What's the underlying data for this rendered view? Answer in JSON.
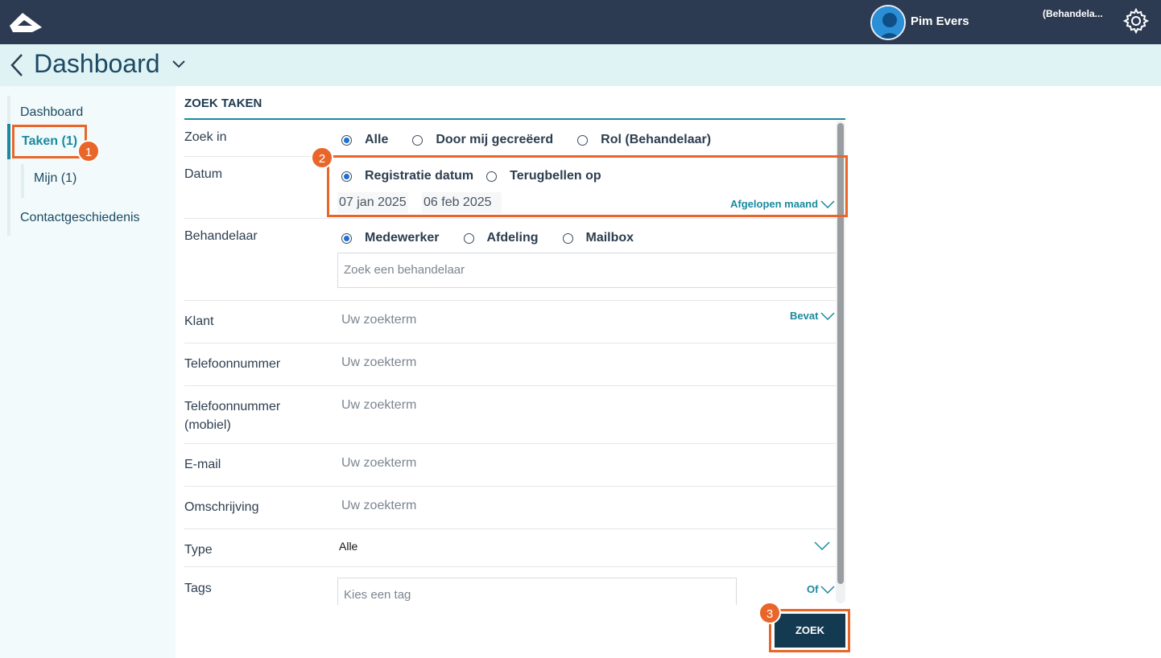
{
  "header": {
    "user_name": "Pim Evers",
    "role": "(Behandela..."
  },
  "titlebar": {
    "title": "Dashboard"
  },
  "sidebar": {
    "items": [
      {
        "label": "Dashboard"
      },
      {
        "label": "Taken (1)"
      },
      {
        "label": "Mijn (1)"
      },
      {
        "label": "Contactgeschiedenis"
      }
    ]
  },
  "panel": {
    "title": "ZOEK TAKEN",
    "zoek_in": {
      "label": "Zoek in",
      "options": [
        "Alle",
        "Door mij gecreëerd",
        "Rol (Behandelaar)"
      ],
      "selected": "Alle"
    },
    "datum": {
      "label": "Datum",
      "options": [
        "Registratie datum",
        "Terugbellen op"
      ],
      "selected": "Registratie datum",
      "from": "07 jan 2025",
      "to": "06 feb 2025",
      "range": "Afgelopen maand"
    },
    "behandelaar": {
      "label": "Behandelaar",
      "options": [
        "Medewerker",
        "Afdeling",
        "Mailbox"
      ],
      "selected": "Medewerker",
      "placeholder": "Zoek een behandelaar"
    },
    "klant": {
      "label": "Klant",
      "placeholder": "Uw zoekterm",
      "match": "Bevat"
    },
    "telefoon": {
      "label": "Telefoonnummer",
      "placeholder": "Uw zoekterm"
    },
    "telefoon_mobiel": {
      "label_line1": "Telefoonnummer",
      "label_line2": "(mobiel)",
      "placeholder": "Uw zoekterm"
    },
    "email": {
      "label": "E-mail",
      "placeholder": "Uw zoekterm"
    },
    "omschrijving": {
      "label": "Omschrijving",
      "placeholder": "Uw zoekterm"
    },
    "type": {
      "label": "Type",
      "value": "Alle"
    },
    "tags": {
      "label": "Tags",
      "placeholder": "Kies een tag",
      "operator": "Of"
    },
    "search_button": "ZOEK"
  },
  "annotations": [
    "1",
    "2",
    "3"
  ],
  "colors": {
    "topbar": "#2d3b52",
    "titlebar": "#dff3f5",
    "accent": "#1a8aa0",
    "highlight": "#e8662a",
    "button": "#143a52"
  }
}
